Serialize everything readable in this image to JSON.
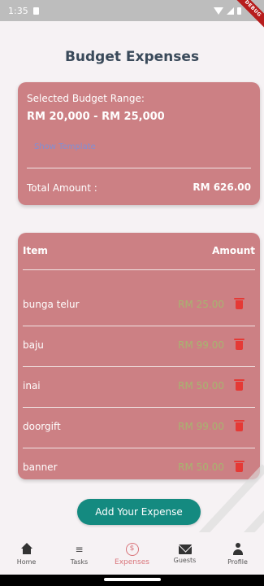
{
  "status_bar": {
    "time": "1:35",
    "debug_label": "DEBUG"
  },
  "page": {
    "title": "Budget Expenses"
  },
  "budget": {
    "label": "Selected Budget Range:",
    "range": "RM 20,000 - RM 25,000",
    "template_link": "Show Template",
    "total_label": "Total Amount :",
    "total_amount": "RM 626.00"
  },
  "table": {
    "header_item": "Item",
    "header_amount": "Amount",
    "rows": [
      {
        "name": "bunga telur",
        "amount": "RM 25.00"
      },
      {
        "name": "baju",
        "amount": "RM 99.00"
      },
      {
        "name": "inai",
        "amount": "RM 50.00"
      },
      {
        "name": "doorgift",
        "amount": "RM 99.00"
      },
      {
        "name": "banner",
        "amount": "RM 50.00"
      }
    ]
  },
  "add_button": {
    "label": "Add Your Expense"
  },
  "bottom_nav": {
    "items": [
      {
        "label": "Home",
        "icon": "home-icon"
      },
      {
        "label": "Tasks",
        "icon": "checklist-icon"
      },
      {
        "label": "Expenses",
        "icon": "dollar-icon"
      },
      {
        "label": "Guests",
        "icon": "mail-icon"
      },
      {
        "label": "Profile",
        "icon": "person-icon"
      }
    ],
    "active_index": 2
  },
  "colors": {
    "card": "#cc8084",
    "accent": "#148a80",
    "amount_text": "#a7b46f",
    "delete": "#e53935",
    "active_nav": "#d9747a",
    "title": "#3a4a5a"
  }
}
